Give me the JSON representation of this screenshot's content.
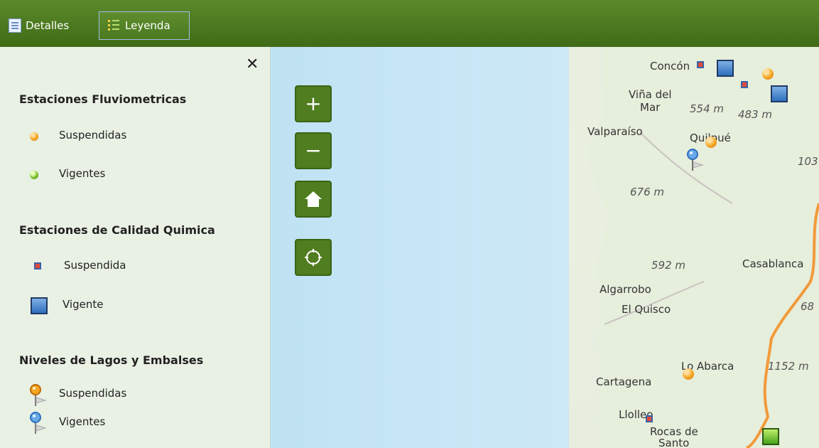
{
  "topbar": {
    "tabs": [
      {
        "label": "Detalles",
        "icon": "details-doc-icon"
      },
      {
        "label": "Leyenda",
        "icon": "legend-list-icon"
      }
    ]
  },
  "sidebar": {
    "close_icon": "close-icon",
    "sections": [
      {
        "title": "Estaciones Fluviometricas",
        "items": [
          {
            "label": "Suspendidas",
            "icon": "orange-circle-icon"
          },
          {
            "label": "Vigentes",
            "icon": "green-circle-icon"
          }
        ]
      },
      {
        "title": "Estaciones de Calidad Quimica",
        "items": [
          {
            "label": "Suspendida",
            "icon": "red-square-icon"
          },
          {
            "label": "Vigente",
            "icon": "blue-square-icon"
          }
        ]
      },
      {
        "title": "Niveles de Lagos y Embalses",
        "items": [
          {
            "label": "Suspendidas",
            "icon": "orange-pin-icon"
          },
          {
            "label": "Vigentes",
            "icon": "blue-pin-icon"
          }
        ]
      }
    ]
  },
  "map": {
    "controls": {
      "zoom_in": "+",
      "zoom_out": "−"
    },
    "labels": {
      "concon": "Concón",
      "vina": "Viña del",
      "mar": "Mar",
      "valparaiso": "Valparaíso",
      "quilpue": "Quilpué",
      "casablanca": "Casablanca",
      "algarrobo": "Algarrobo",
      "el_quisco": "El Quisco",
      "lo_abarca": "Lo Abarca",
      "cartagena": "Cartagena",
      "llolleo": "Llolleo",
      "rocas": "Rocas de",
      "santo": "Santo",
      "e554": "554 m",
      "e483": "483 m",
      "e676": "676 m",
      "e592": "592 m",
      "e1152": "1152 m",
      "e103": "103",
      "e68": "68"
    },
    "colors": {
      "accent": "#4f7d1f",
      "water": "#cbe8f6",
      "boundary": "#f29a3a"
    }
  }
}
